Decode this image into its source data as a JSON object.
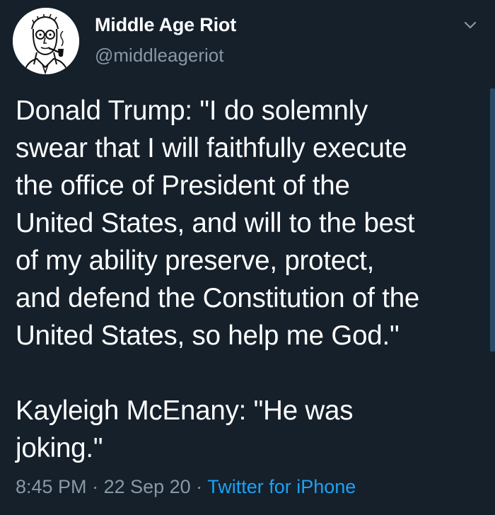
{
  "author": {
    "display_name": "Middle Age Riot",
    "handle": "@middleageriot",
    "avatar_icon": "cartoon-man-with-pipe-avatar"
  },
  "tweet": {
    "text": "Donald Trump: \"I do solemnly\nswear that I will faithfully execute\nthe office of President of the\nUnited States, and will to the best\nof my ability preserve, protect,\nand defend the Constitution of the\nUnited States, so help me God.\"\n\nKayleigh McEnany: \"He was\njoking.\""
  },
  "meta": {
    "time": "8:45 PM",
    "separator": " · ",
    "date": "22 Sep 20",
    "source": "Twitter for iPhone"
  },
  "menu_icon": "chevron-down-icon",
  "colors": {
    "background": "#15202b",
    "primary_text": "#ffffff",
    "secondary_text": "#8899a6",
    "link": "#1da1f2"
  }
}
